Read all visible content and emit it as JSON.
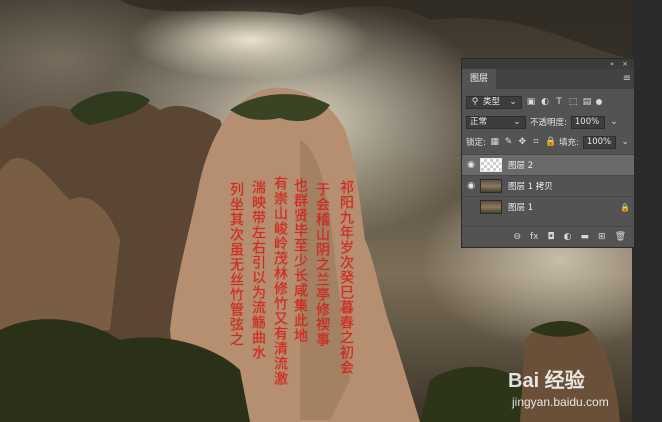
{
  "canvas": {
    "poem_columns": [
      "祁阳九年岁次癸巳暮春之初会",
      "于会稽山阴之兰亭修禊事",
      "也群贤毕至少长咸集此地",
      "有崇山峻岭茂林修竹又有清流激",
      "湍映带左右引以为流觞曲水",
      "列坐其次虽无丝竹管弦之"
    ],
    "watermark_main": "Bai 经验",
    "watermark_sub": "jingyan.baidu.com"
  },
  "layers_panel": {
    "top_controls": [
      "«",
      "×"
    ],
    "tab_label": "图层",
    "menu_icon": "≡",
    "filter": {
      "label": "类型",
      "icons": [
        "image-filter-icon",
        "adjustment-filter-icon",
        "type-filter-icon",
        "shape-filter-icon",
        "smart-object-filter-icon"
      ]
    },
    "blend_mode": "正常",
    "opacity_label": "不透明度:",
    "opacity_value": "100%",
    "lock_label": "锁定:",
    "fill_label": "填充:",
    "fill_value": "100%",
    "layers": [
      {
        "name": "图层 2",
        "visible": true,
        "selected": true,
        "thumb": "transparent",
        "locked": false
      },
      {
        "name": "图层 1 拷贝",
        "visible": true,
        "selected": false,
        "thumb": "image",
        "locked": false
      },
      {
        "name": "图层 1",
        "visible": false,
        "selected": false,
        "thumb": "image",
        "locked": true
      }
    ],
    "footer_icons": [
      "link-icon",
      "fx-icon",
      "mask-icon",
      "adjustment-icon",
      "folder-icon",
      "new-layer-icon",
      "trash-icon"
    ],
    "footer_glyphs": [
      "⊖",
      "fx",
      "◘",
      "◐",
      "▬",
      "⊞",
      "🗑"
    ]
  },
  "colors": {
    "calligraphy": "#e0231d",
    "panel_bg": "#535353",
    "selected_layer": "#6a6a6a"
  }
}
